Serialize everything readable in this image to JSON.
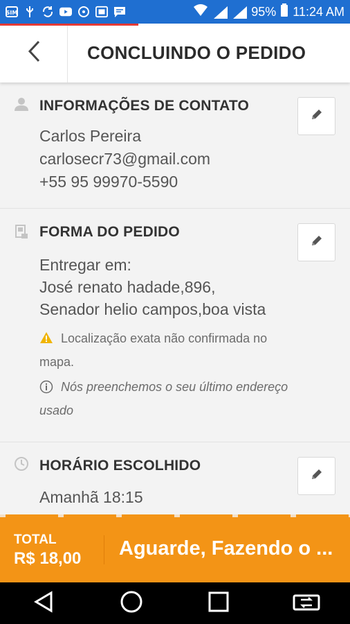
{
  "status_bar": {
    "battery": "95%",
    "time": "11:24 AM",
    "signal_badges": [
      "4G",
      "R"
    ]
  },
  "toolbar": {
    "title": "CONCLUINDO O PEDIDO"
  },
  "contact": {
    "title": "INFORMAÇÕES DE CONTATO",
    "name": "Carlos Pereira",
    "email": "carlosecr73@gmail.com",
    "phone": "+55 95 99970-5590"
  },
  "order_form": {
    "title": "FORMA DO PEDIDO",
    "deliver_label": "Entregar em:",
    "address_line1": "José renato hadade,896,",
    "address_line2": "Senador helio campos,boa vista",
    "warning": "Localização exata não confirmada no mapa.",
    "info": "Nós preenchemos o seu último endereço usado"
  },
  "schedule": {
    "title": "HORÁRIO ESCOLHIDO",
    "time": "Amanhã 18:15"
  },
  "footer": {
    "total_label": "TOTAL",
    "total_value": "R$ 18,00",
    "submit_label": "Aguarde, Fazendo o ..."
  },
  "colors": {
    "status_bar": "#1f6fd1",
    "accent": "#f39416",
    "warning": "#f0b400"
  }
}
